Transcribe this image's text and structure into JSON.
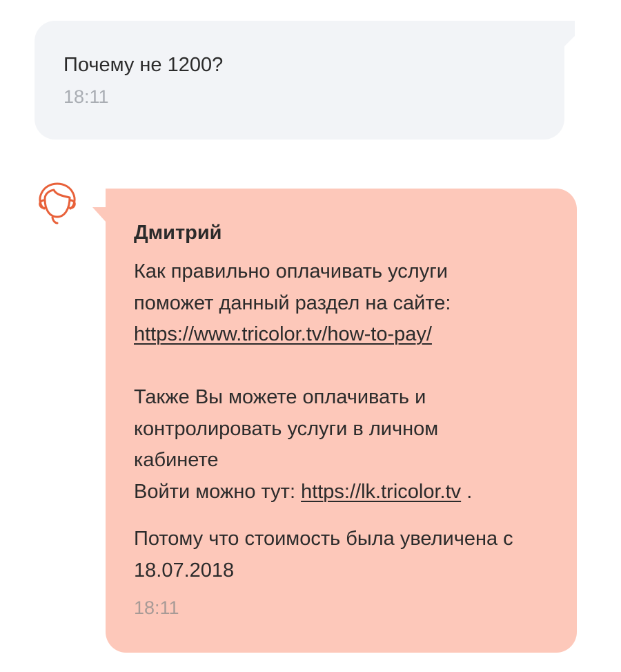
{
  "colors": {
    "outgoing_bubble": "#f2f4f7",
    "incoming_bubble": "#fdc8ba",
    "avatar_stroke": "#e8613a",
    "text": "#2b2b2b",
    "time_text": "#a9adb3"
  },
  "outgoing_message": {
    "text": "Почему не 1200?",
    "time": "18:11"
  },
  "incoming_message": {
    "avatar_icon": "operator-avatar-icon",
    "sender": "Дмитрий",
    "paragraph1": {
      "line1": "Как правильно оплачивать услуги",
      "line2": "поможет данный раздел на сайте:",
      "link": "https://www.tricolor.tv/how-to-pay/"
    },
    "paragraph2": {
      "line1": "Также Вы можете оплачивать и",
      "line2": "контролировать услуги в личном",
      "line3": "кабинете",
      "login_prefix": "Войти можно тут: ",
      "login_link": "https://lk.tricolor.tv",
      "login_suffix": " ."
    },
    "paragraph3": {
      "line1": "Потому что стоимость была увеличена с",
      "line2": "18.07.2018"
    },
    "time": "18:11"
  }
}
